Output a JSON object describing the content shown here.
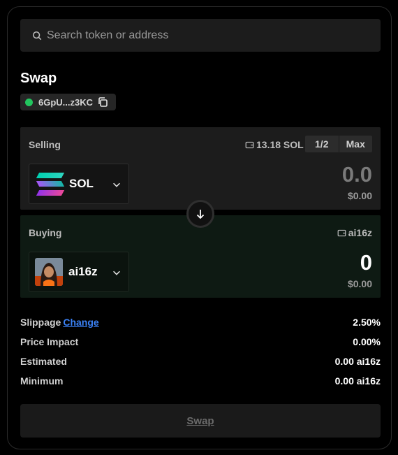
{
  "search": {
    "placeholder": "Search token or address"
  },
  "swap_title": "Swap",
  "wallet": {
    "address": "6GpU...z3KC",
    "status_color": "#22c55e"
  },
  "selling": {
    "label": "Selling",
    "balance": "13.18 SOL",
    "half_label": "1/2",
    "max_label": "Max",
    "token": "SOL",
    "token_icon": "solana-logo",
    "amount": "0.0",
    "usd": "$0.00"
  },
  "buying": {
    "label": "Buying",
    "balance": "ai16z",
    "token": "ai16z",
    "token_icon": "ai16z-avatar",
    "amount": "0",
    "usd": "$0.00"
  },
  "details": {
    "slippage_label": "Slippage",
    "slippage_change": "Change",
    "slippage_value": "2.50%",
    "price_impact_label": "Price Impact",
    "price_impact_value": "0.00%",
    "estimated_label": "Estimated",
    "estimated_value": "0.00 ai16z",
    "minimum_label": "Minimum",
    "minimum_value": "0.00 ai16z"
  },
  "swap_button": "Swap",
  "colors": {
    "accent_link": "#3b82f6",
    "buy_panel_bg": "#0e1a13",
    "sell_panel_bg": "#1c1c1c"
  }
}
